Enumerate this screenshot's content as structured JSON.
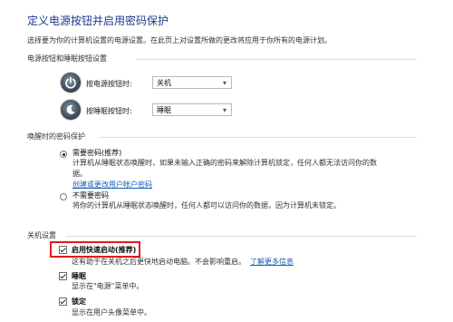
{
  "header": {
    "title": "定义电源按钮并启用密码保护",
    "description": "选择要为你的计算机设置的电源设置。在此页上对设置所做的更改将应用于你所有的电源计划。"
  },
  "buttons_section": {
    "title": "电源按钮和睡眠按钮设置",
    "power_label": "按电源按钮时:",
    "power_value": "关机",
    "sleep_label": "按睡眠按钮时:",
    "sleep_value": "睡眠"
  },
  "password_section": {
    "title": "唤醒时的密码保护",
    "require": {
      "title": "需要密码(推荐)",
      "desc1": "计算机从睡眠状态唤醒时，如果未输入正确的密码来解除计算机锁定，任何人都无法访问你的数",
      "desc2": "据。",
      "link": "创建或更改用户帐户密码",
      "selected": true
    },
    "no_require": {
      "title": "不需要密码",
      "desc": "将你的计算机从睡眠状态唤醒时，任何人都可以访问你的数据，因为计算机未锁定。",
      "selected": false
    }
  },
  "shutdown_section": {
    "title": "关机设置",
    "fast_startup": {
      "label": "启用快速启动(推荐)",
      "desc": "这有助于在关机之后更快地启动电脑。不会影响重启。",
      "link": "了解更多信息",
      "checked": true
    },
    "sleep": {
      "label": "睡眠",
      "desc": "显示在\"电源\"菜单中。",
      "checked": true
    },
    "lock": {
      "label": "锁定",
      "desc": "显示在用户头像菜单中。",
      "checked": true
    }
  },
  "colors": {
    "title": "#1e3a8c",
    "link": "#1a5fb4",
    "highlight": "#e01b1b"
  }
}
